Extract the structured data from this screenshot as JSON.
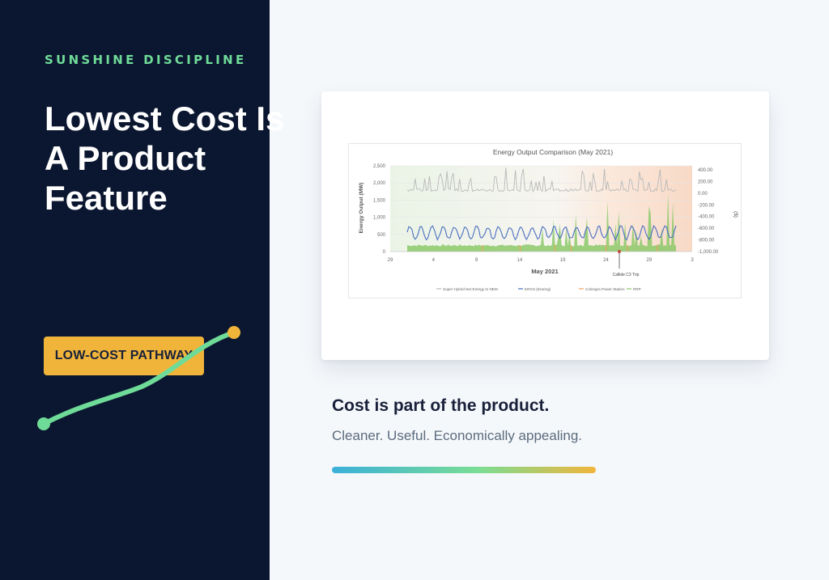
{
  "sidebar": {
    "kicker": "SUNSHINE DISCIPLINE",
    "headline_lines": [
      "Lowest Cost Is",
      "A Product",
      "Feature"
    ],
    "pathway_label": "LOW-COST PATHWAY"
  },
  "caption": {
    "title": "Cost is part of the product.",
    "subtitle": "Cleaner. Useful. Economically appealing."
  },
  "colors": {
    "navy": "#0b1730",
    "accent_green": "#6fdb98",
    "accent_orange": "#f0b43a",
    "gradient": [
      "#3ab0d9",
      "#79dd95",
      "#f1b53b"
    ]
  },
  "chart_data": {
    "type": "line",
    "title": "Energy Output Comparison (May 2021)",
    "xlabel": "May 2021",
    "ylabel": "Energy Output (MW)",
    "y2label": "($)",
    "x_ticks": [
      "29",
      "4",
      "9",
      "14",
      "19",
      "24",
      "29",
      "3"
    ],
    "y_ticks": [
      "0",
      "500",
      "1,000",
      "1,500",
      "2,000",
      "2,500"
    ],
    "y2_ticks": [
      "400.00",
      "200.00",
      "0.00",
      "-200.00",
      "-400.00",
      "-600.00",
      "-800.00",
      "-1,000.00"
    ],
    "ylim": [
      0,
      2500
    ],
    "y2lim": [
      -1000,
      400
    ],
    "annotation": "Callide C3 Trip",
    "series": [
      {
        "name": "Super Hybrid Net Energy to NEM",
        "color": "#b9b9b9",
        "approx_level": 1750
      },
      {
        "name": "ERGS (Eraring)",
        "color": "#4a6fc0",
        "approx_level": 550
      },
      {
        "name": "Colongra Power Station",
        "color": "#f0a05a",
        "approx_level": 50
      },
      {
        "name": "RRP",
        "color": "#8cc96a",
        "approx_level": 150
      }
    ]
  }
}
